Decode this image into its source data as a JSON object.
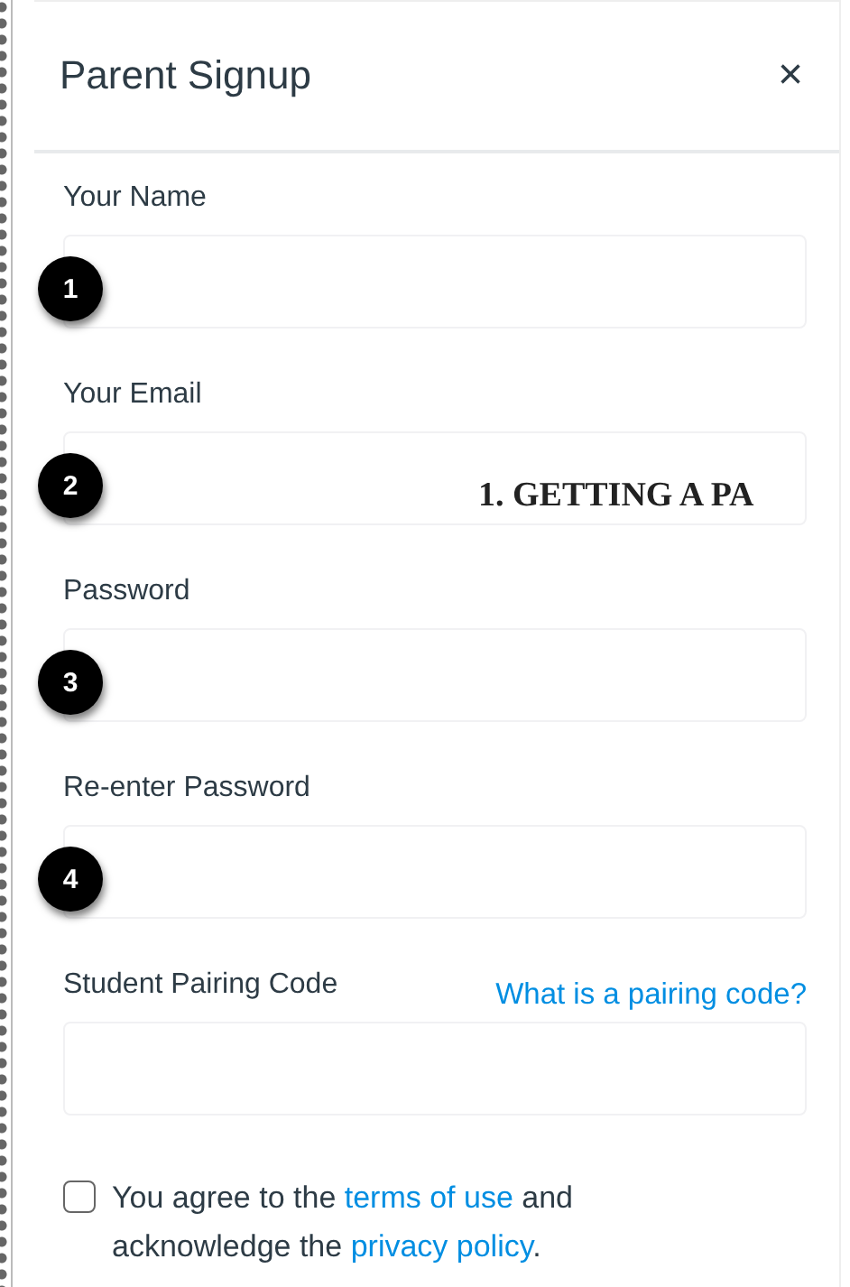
{
  "dialog": {
    "title": "Parent Signup",
    "close": "×"
  },
  "fields": [
    {
      "label": "Your Name",
      "badge": "1"
    },
    {
      "label": "Your Email",
      "badge": "2"
    },
    {
      "label": "Password",
      "badge": "3"
    },
    {
      "label": "Re-enter Password",
      "badge": "4"
    },
    {
      "label": "Student Pairing Code",
      "help_link": "What is a pairing code?"
    }
  ],
  "background_heading": "1. GETTING A PA",
  "agreement": {
    "checked": false,
    "parts": [
      {
        "kind": "text",
        "text": "You agree to the "
      },
      {
        "kind": "link",
        "text": "terms of use"
      },
      {
        "kind": "text",
        "text": " and acknowledge the "
      },
      {
        "kind": "link",
        "text": "privacy policy"
      },
      {
        "kind": "text",
        "text": "."
      }
    ]
  }
}
